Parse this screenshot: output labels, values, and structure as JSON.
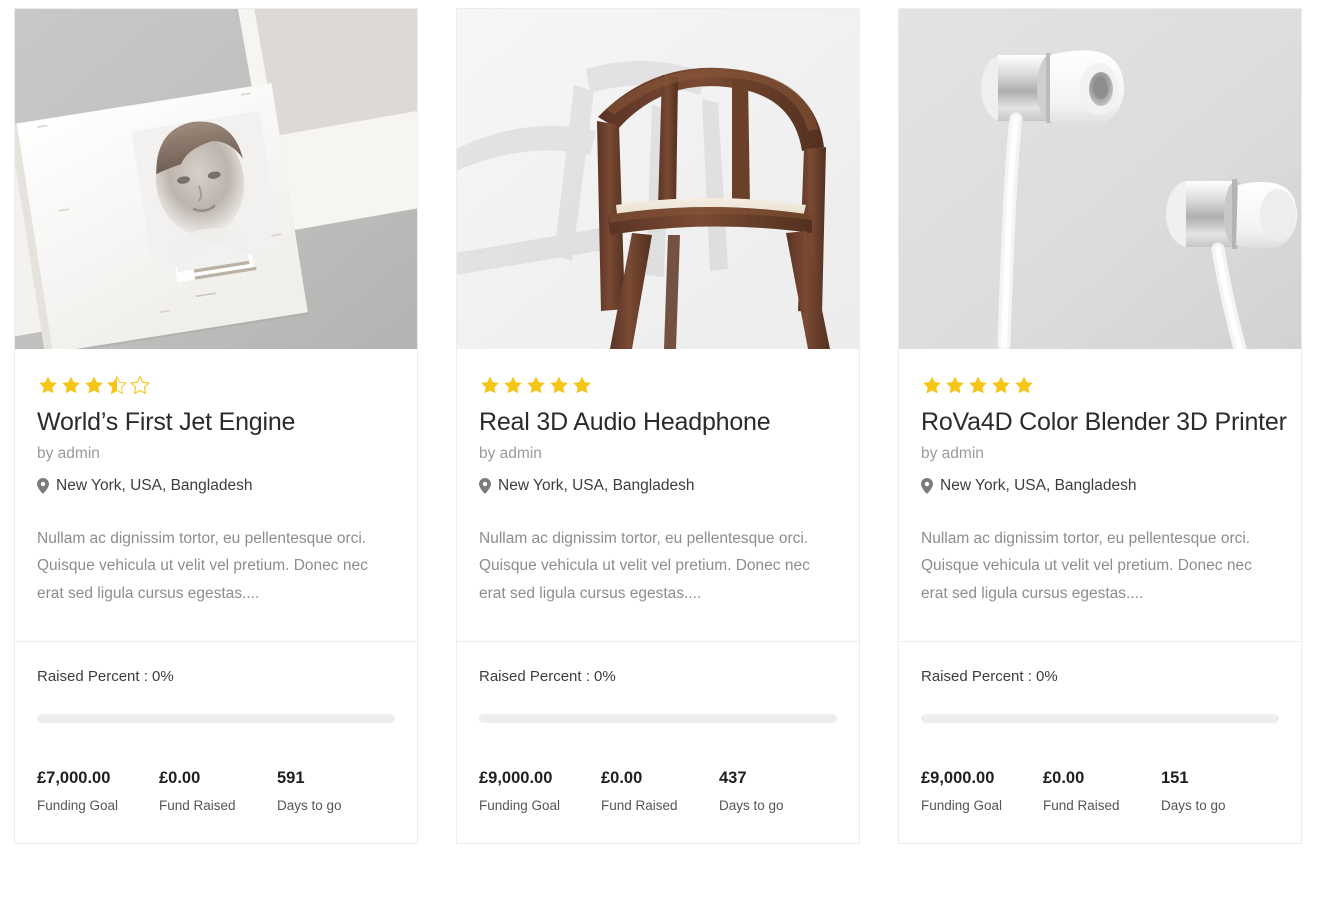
{
  "theme": {
    "page_background": "#ffffff",
    "card_background": "#ffffff",
    "card_border": "#ededed",
    "star_color": "#f5c518",
    "progress_track": "#eeeeee",
    "title_color": "#2b2b2b",
    "muted_text": "#9a9a9a",
    "description_color": "#8d8d8d"
  },
  "cards": [
    {
      "image": {
        "name": "magazine-brochure-photo",
        "alt": "Open magazine spread with a portrait photograph on a gray surface",
        "background": "#c2c2c2"
      },
      "rating": {
        "value": 3.5,
        "max": 5,
        "full": 3,
        "half": 1,
        "empty": 1
      },
      "title": "World’s First Jet Engine",
      "author": "by admin",
      "location": "New York, USA, Bangladesh",
      "description": "Nullam ac dignissim tortor, eu pellentesque orci. Quisque vehicula ut velit vel pretium. Donec nec erat sed ligula cursus egestas....",
      "raised_percent_label": "Raised Percent : 0%",
      "raised_percent_value": 0,
      "stats": [
        {
          "value": "£7,000.00",
          "label": "Funding Goal"
        },
        {
          "value": "£0.00",
          "label": "Fund Raised"
        },
        {
          "value": "591",
          "label": "Days to go"
        }
      ]
    },
    {
      "image": {
        "name": "wooden-chair-photo",
        "alt": "Dark walnut wooden armchair with cream seat on a white background",
        "background": "#f2f2f2"
      },
      "rating": {
        "value": 5,
        "max": 5,
        "full": 5,
        "half": 0,
        "empty": 0
      },
      "title": "Real 3D Audio Headphone",
      "author": "by admin",
      "location": "New York, USA, Bangladesh",
      "description": "Nullam ac dignissim tortor, eu pellentesque orci. Quisque vehicula ut velit vel pretium. Donec nec erat sed ligula cursus egestas....",
      "raised_percent_label": "Raised Percent : 0%",
      "raised_percent_value": 0,
      "stats": [
        {
          "value": "£9,000.00",
          "label": "Funding Goal"
        },
        {
          "value": "£0.00",
          "label": "Fund Raised"
        },
        {
          "value": "437",
          "label": "Days to go"
        }
      ]
    },
    {
      "image": {
        "name": "earbud-headphones-photo",
        "alt": "Pair of silver and white in-ear headphones on a light gray background",
        "background": "#dcdcdc"
      },
      "rating": {
        "value": 5,
        "max": 5,
        "full": 5,
        "half": 0,
        "empty": 0
      },
      "title": "RoVa4D Color Blender 3D Printer",
      "author": "by admin",
      "location": "New York, USA, Bangladesh",
      "description": "Nullam ac dignissim tortor, eu pellentesque orci. Quisque vehicula ut velit vel pretium. Donec nec erat sed ligula cursus egestas....",
      "raised_percent_label": "Raised Percent : 0%",
      "raised_percent_value": 0,
      "stats": [
        {
          "value": "£9,000.00",
          "label": "Funding Goal"
        },
        {
          "value": "£0.00",
          "label": "Fund Raised"
        },
        {
          "value": "151",
          "label": "Days to go"
        }
      ]
    }
  ]
}
